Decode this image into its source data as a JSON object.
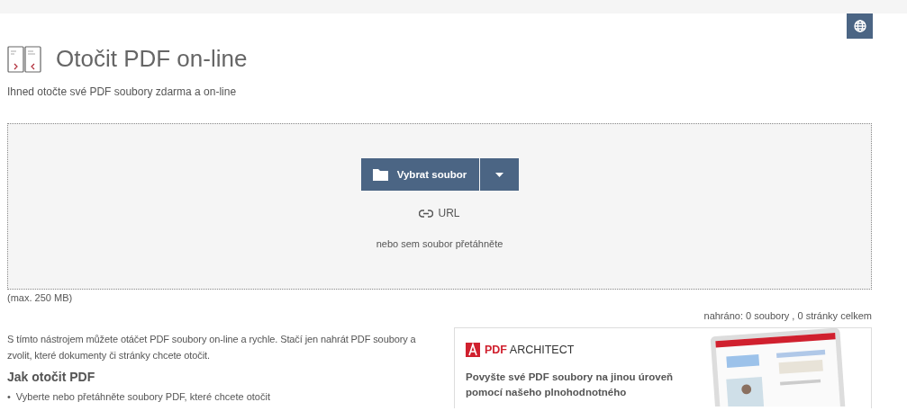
{
  "header": {
    "title": "Otočit PDF on-line",
    "subtitle": "Ihned otočte své PDF soubory zdarma a on-line"
  },
  "upload": {
    "choose_button": "Vybrat soubor",
    "url_link": "URL",
    "drop_hint": "nebo sem soubor přetáhněte",
    "max_size": "(max. 250 MB)",
    "status": "nahráno: 0 soubory , 0 stránky celkem"
  },
  "intro": "S tímto nástrojem můžete otáčet PDF soubory on-line a rychle. Stačí jen nahrát PDF soubory a zvolit, které dokumenty či stránky chcete otočit.",
  "how_to": {
    "heading": "Jak otočit PDF",
    "bullet": "•",
    "steps": [
      "Vyberte nebo přetáhněte soubory PDF, které chcete otočit"
    ]
  },
  "ad": {
    "brand_bold": "PDF",
    "brand_rest": "ARCHITECT",
    "text": "Povyšte své PDF soubory na jinou úroveň pomocí našeho plnohodnotného"
  }
}
